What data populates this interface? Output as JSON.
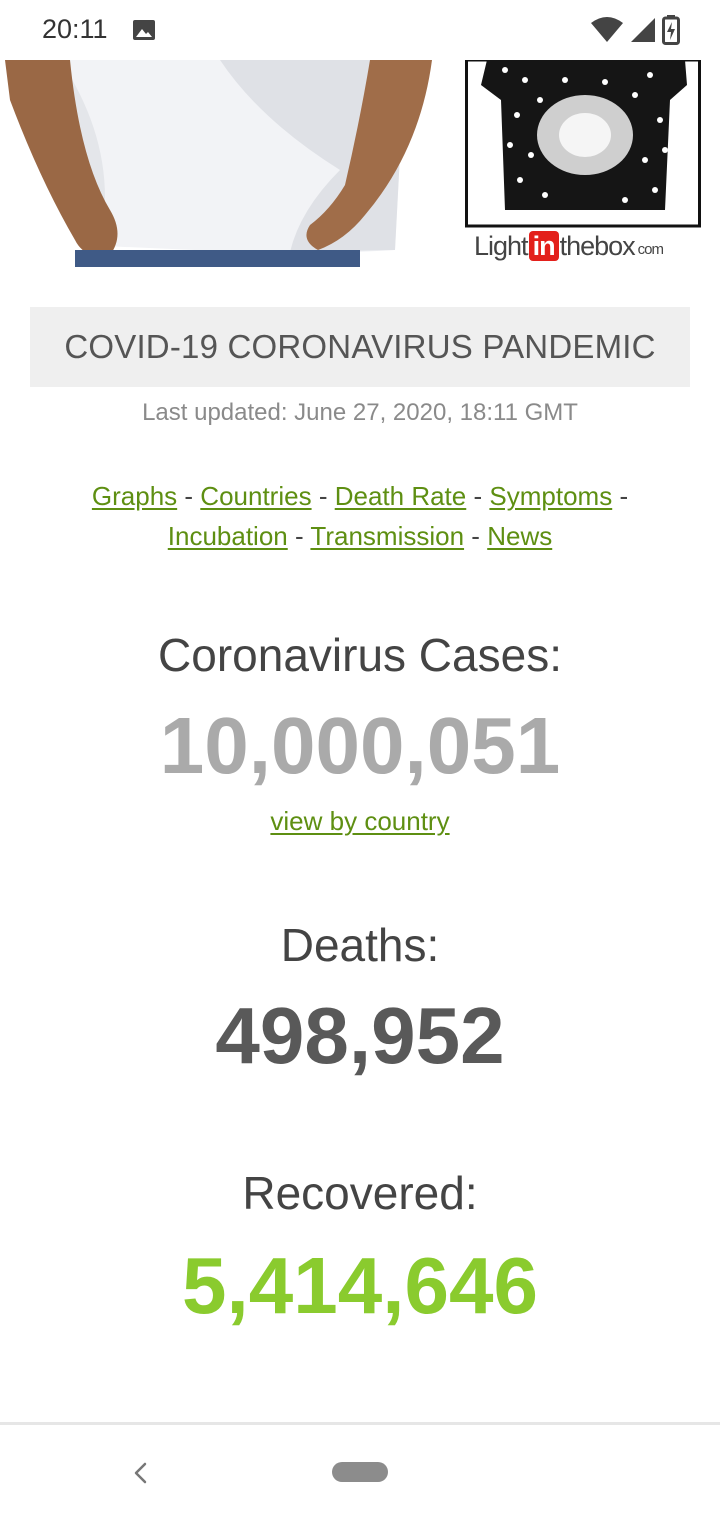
{
  "status_bar": {
    "time": "20:11",
    "icons": [
      "image-icon",
      "wifi-icon",
      "signal-icon",
      "battery-charging-icon"
    ]
  },
  "ad": {
    "brand_pre": "Light",
    "brand_in": "in",
    "brand_post": "thebox",
    "brand_suffix": "com"
  },
  "header": {
    "title": "COVID-19 CORONAVIRUS PANDEMIC",
    "last_updated": "Last updated: June 27, 2020, 18:11 GMT"
  },
  "nav_links": [
    "Graphs",
    "Countries",
    "Death Rate",
    "Symptoms",
    "Incubation",
    "Transmission",
    "News"
  ],
  "nav_separator": "-",
  "counters": {
    "cases_label": "Coronavirus Cases:",
    "cases_value": "10,000,051",
    "view_by_country": "view by country",
    "deaths_label": "Deaths:",
    "deaths_value": "498,952",
    "recovered_label": "Recovered:",
    "recovered_value": "5,414,646"
  },
  "colors": {
    "link": "#5e8f12",
    "cases": "#aaaaaa",
    "deaths": "#595959",
    "recovered": "#8acb2e"
  }
}
